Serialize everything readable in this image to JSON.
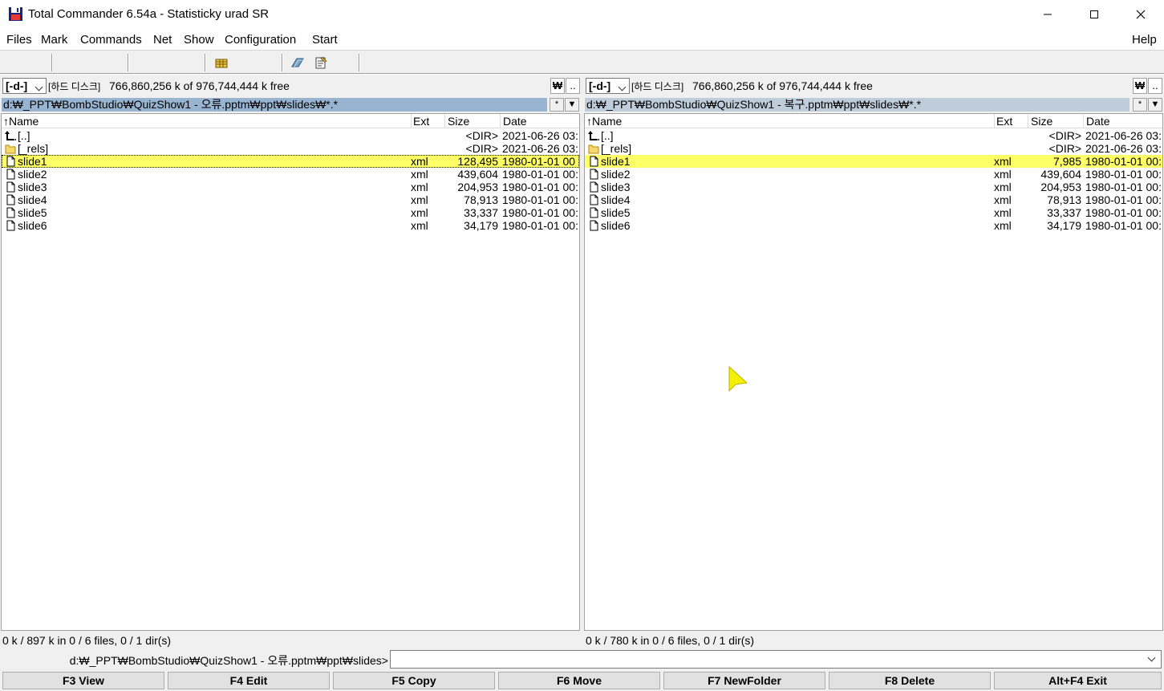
{
  "window": {
    "title": "Total Commander 6.54a - Statisticky urad SR",
    "minimize_icon": "minimize-icon",
    "maximize_icon": "maximize-icon",
    "close_icon": "close-icon"
  },
  "menu": {
    "items": [
      "Files",
      "Mark",
      "Commands",
      "Net",
      "Show",
      "Configuration",
      "Start"
    ],
    "help": "Help"
  },
  "left_panel": {
    "drive": "[-d-]",
    "drive_label": "[하드 디스크]",
    "free_space": "766,860,256 k of 976,744,444 k free",
    "root_btn": "₩",
    "parent_btn": "..",
    "path": "d:₩_PPT₩BombStudio₩QuizShow1 - 오류.pptm₩ppt₩slides₩*.*",
    "path_active": true,
    "headers": {
      "name": "↑Name",
      "ext": "Ext",
      "size": "Size",
      "date": "Date"
    },
    "rows": [
      {
        "icon": "parent-up-icon",
        "name": "[..]",
        "ext": "",
        "size": "<DIR>",
        "date": "2021-06-26 03:"
      },
      {
        "icon": "folder-icon",
        "name": "[_rels]",
        "ext": "",
        "size": "<DIR>",
        "date": "2021-06-26 03:"
      },
      {
        "icon": "file-icon",
        "name": "slide1",
        "ext": "xml",
        "size": "128,495",
        "date": "1980-01-01 00"
      },
      {
        "icon": "file-icon",
        "name": "slide2",
        "ext": "xml",
        "size": "439,604",
        "date": "1980-01-01 00:"
      },
      {
        "icon": "file-icon",
        "name": "slide3",
        "ext": "xml",
        "size": "204,953",
        "date": "1980-01-01 00:"
      },
      {
        "icon": "file-icon",
        "name": "slide4",
        "ext": "xml",
        "size": "78,913",
        "date": "1980-01-01 00:"
      },
      {
        "icon": "file-icon",
        "name": "slide5",
        "ext": "xml",
        "size": "33,337",
        "date": "1980-01-01 00:"
      },
      {
        "icon": "file-icon",
        "name": "slide6",
        "ext": "xml",
        "size": "34,179",
        "date": "1980-01-01 00:"
      }
    ],
    "status": "0 k / 897 k in 0 / 6 files, 0 / 1 dir(s)"
  },
  "right_panel": {
    "drive": "[-d-]",
    "drive_label": "[하드 디스크]",
    "free_space": "766,860,256 k of 976,744,444 k free",
    "root_btn": "₩",
    "parent_btn": "..",
    "path": "d:₩_PPT₩BombStudio₩QuizShow1 - 복구.pptm₩ppt₩slides₩*.*",
    "path_active": false,
    "headers": {
      "name": "↑Name",
      "ext": "Ext",
      "size": "Size",
      "date": "Date"
    },
    "rows": [
      {
        "icon": "parent-up-icon",
        "name": "[..]",
        "ext": "",
        "size": "<DIR>",
        "date": "2021-06-26 03:"
      },
      {
        "icon": "folder-icon",
        "name": "[_rels]",
        "ext": "",
        "size": "<DIR>",
        "date": "2021-06-26 03:"
      },
      {
        "icon": "file-icon",
        "name": "slide1",
        "ext": "xml",
        "size": "7,985",
        "date": "1980-01-01 00:"
      },
      {
        "icon": "file-icon",
        "name": "slide2",
        "ext": "xml",
        "size": "439,604",
        "date": "1980-01-01 00:"
      },
      {
        "icon": "file-icon",
        "name": "slide3",
        "ext": "xml",
        "size": "204,953",
        "date": "1980-01-01 00:"
      },
      {
        "icon": "file-icon",
        "name": "slide4",
        "ext": "xml",
        "size": "78,913",
        "date": "1980-01-01 00:"
      },
      {
        "icon": "file-icon",
        "name": "slide5",
        "ext": "xml",
        "size": "33,337",
        "date": "1980-01-01 00:"
      },
      {
        "icon": "file-icon",
        "name": "slide6",
        "ext": "xml",
        "size": "34,179",
        "date": "1980-01-01 00:"
      }
    ],
    "status": "0 k / 780 k in 0 / 6 files, 0 / 1 dir(s)"
  },
  "command_line": {
    "path": "d:₩_PPT₩BombStudio₩QuizShow1 - 오류.pptm₩ppt₩slides>",
    "value": ""
  },
  "fkeys": [
    "F3 View",
    "F4 Edit",
    "F5 Copy",
    "F6 Move",
    "F7 NewFolder",
    "F8 Delete",
    "Alt+F4 Exit"
  ],
  "toolbar_icons": [
    "multi-rename-icon",
    "compare-icon",
    "notepad-icon"
  ],
  "colors": {
    "active_path_bg": "#99b4d1",
    "inactive_path_bg": "#bfcddb",
    "selection_highlight": "#ffff66",
    "cursor_highlight": "#f0f000"
  }
}
